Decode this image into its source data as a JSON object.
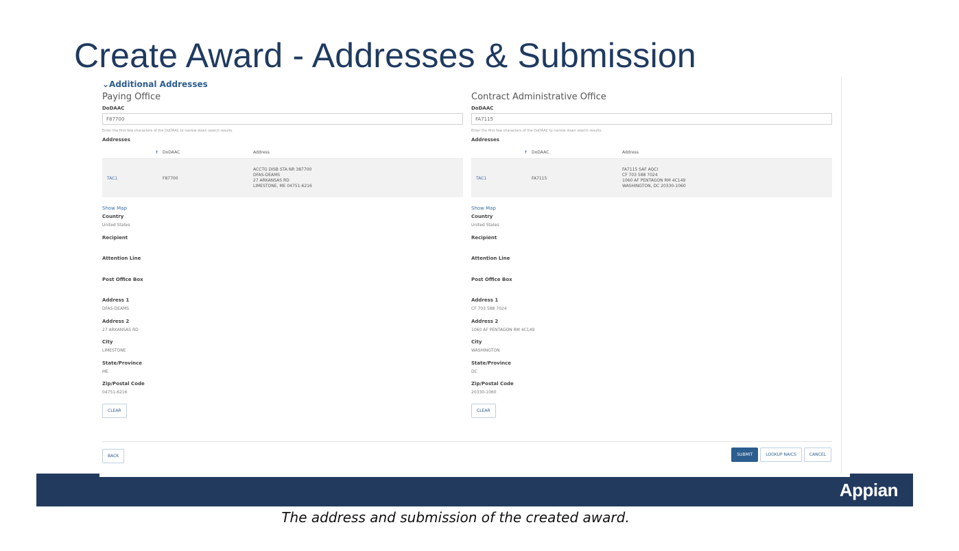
{
  "slide": {
    "title": "Create Award - Addresses & Submission",
    "caption": "The address and submission of the created award.",
    "brand": "Appian"
  },
  "section": {
    "toggle_label": "⌄Additional Addresses"
  },
  "grid_headers": {
    "sort_icon": "↑",
    "dodaac": "DoDAAC",
    "address": "Address"
  },
  "field_labels": {
    "dodaac": "DoDAAC",
    "addresses": "Addresses",
    "show_map": "Show Map",
    "country": "Country",
    "recipient": "Recipient",
    "attention_line": "Attention Line",
    "po_box": "Post Office Box",
    "address1": "Address 1",
    "address2": "Address 2",
    "city": "City",
    "state": "State/Province",
    "zip": "Zip/Postal Code",
    "clear_button": "CLEAR"
  },
  "paying_office": {
    "title": "Paying Office",
    "dodaac_value": "F87700",
    "instructions": "Enter the first few characters of the DoDAAC to narrow down search results.",
    "row": {
      "key": "TAC1",
      "dodaac": "F87700",
      "address_lines": [
        "ACCTG DISB STA NR 387700",
        "DFAS-DEAMS",
        "27 ARKANSAS RD",
        "LIMESTONE, ME 04751-6216"
      ]
    },
    "country": "United States",
    "recipient": "",
    "attention_line": "",
    "po_box": "",
    "address1": "DFAS-DEAMS",
    "address2": "27 ARKANSAS RD",
    "city": "LIMESTONE",
    "state": "ME",
    "zip": "04751-6216"
  },
  "admin_office": {
    "title": "Contract Administrative Office",
    "dodaac_value": "FA7115",
    "instructions": "Enter the first few characters of the DoDAAC to narrow down search results.",
    "row": {
      "key": "TAC1",
      "dodaac": "FA7115",
      "address_lines": [
        "FA7115 SAF AQCI",
        "CF 703 588 7024",
        "1060 AF PENTAGON RM 4C149",
        "WASHINGTON, DC 20330-1060"
      ]
    },
    "country": "United States",
    "recipient": "",
    "attention_line": "",
    "po_box": "",
    "address1": "CF 703 588 7024",
    "address2": "1060 AF PENTAGON RM 4C149",
    "city": "WASHINGTON",
    "state": "DC",
    "zip": "20330-1060"
  },
  "actions": {
    "back": "BACK",
    "submit": "SUBMIT",
    "lookup": "LOOKUP NAICS",
    "cancel": "CANCEL"
  }
}
